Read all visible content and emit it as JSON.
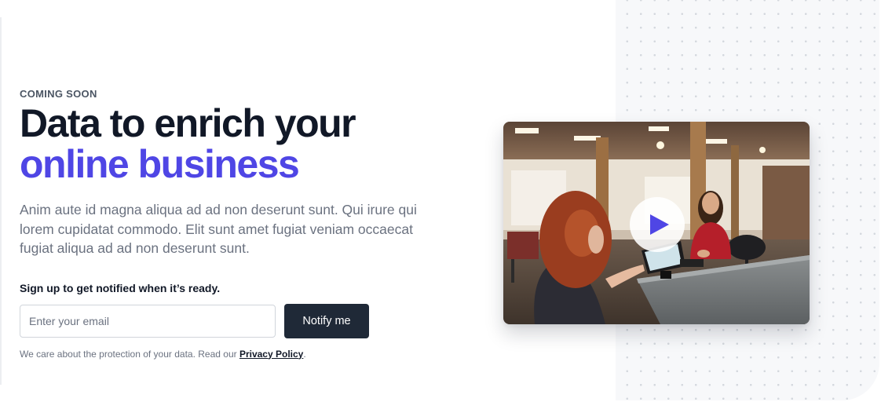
{
  "hero": {
    "eyebrow": "COMING SOON",
    "headline_line1": "Data to enrich your",
    "headline_line2": "online business",
    "description": "Anim aute id magna aliqua ad ad non deserunt sunt. Qui irure qui lorem cupidatat commodo. Elit sunt amet fugiat veniam occaecat fugiat aliqua ad ad non deserunt sunt."
  },
  "signup": {
    "label": "Sign up to get notified when it’s ready.",
    "email_placeholder": "Enter your email",
    "email_value": "",
    "button_label": "Notify me",
    "privacy_prefix": "We care about the protection of your data. Read our ",
    "privacy_link": "Privacy Policy",
    "privacy_suffix": "."
  },
  "video": {
    "thumbnail": "photo-of-two-women-at-shop-counter",
    "play_icon": "play-icon"
  },
  "colors": {
    "accent": "#4f46e5",
    "heading": "#111827",
    "button_bg": "#1f2937",
    "body_text": "#6b7280"
  }
}
